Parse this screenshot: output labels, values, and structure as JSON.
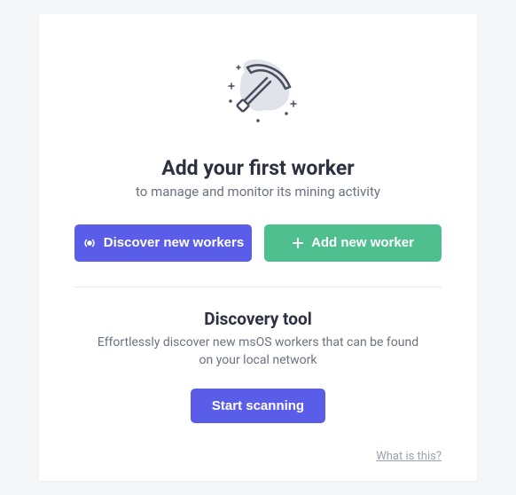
{
  "hero": {
    "title": "Add your first worker",
    "subtitle": "to manage and monitor its mining activity"
  },
  "buttons": {
    "discover": "Discover new workers",
    "add": "Add new worker"
  },
  "discovery": {
    "title": "Discovery tool",
    "description": "Effortlessly discover new msOS workers that can be found on your local network",
    "scan": "Start scanning"
  },
  "footer": {
    "help": "What is this?"
  },
  "colors": {
    "primary": "#5a5de8",
    "success": "#4fbf8f"
  }
}
